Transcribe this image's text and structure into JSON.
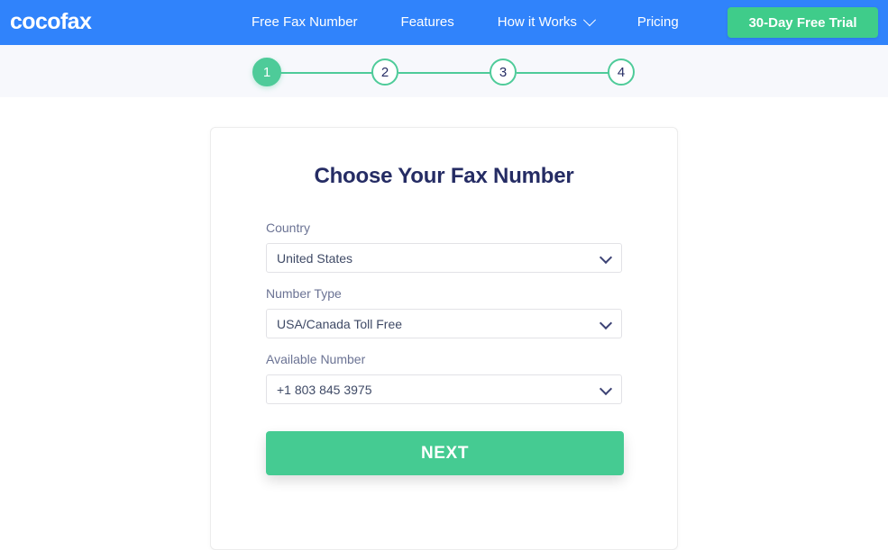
{
  "navbar": {
    "brand": "cocofax",
    "links": [
      {
        "label": "Free Fax Number",
        "has_caret": false
      },
      {
        "label": "Features",
        "has_caret": false
      },
      {
        "label": "How it Works",
        "has_caret": true
      },
      {
        "label": "Pricing",
        "has_caret": false
      }
    ],
    "cta_label": "30-Day Free Trial",
    "background_color": "#3083fb",
    "cta_color": "#3fcc8a"
  },
  "stepper": {
    "current_step": 1,
    "steps": [
      {
        "number": "1",
        "active": true
      },
      {
        "number": "2",
        "active": false
      },
      {
        "number": "3",
        "active": false
      },
      {
        "number": "4",
        "active": false
      }
    ],
    "accent_color": "#4ecb99",
    "band_color": "#f7f8fc"
  },
  "card": {
    "title": "Choose Your Fax Number",
    "title_color": "#252c64",
    "fields": [
      {
        "label": "Country",
        "value": "United States"
      },
      {
        "label": "Number Type",
        "value": "USA/Canada Toll Free"
      },
      {
        "label": "Available Number",
        "value": "+1 803 845 3975"
      }
    ],
    "submit_label": "NEXT",
    "submit_color": "#45cb92"
  }
}
